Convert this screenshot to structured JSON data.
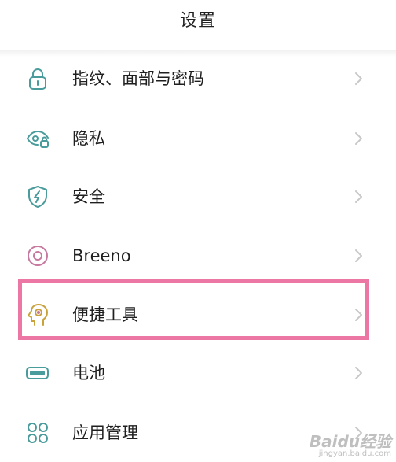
{
  "header": {
    "title": "设置"
  },
  "rows": [
    {
      "label": "指纹、面部与密码",
      "icon": "lock-icon"
    },
    {
      "label": "隐私",
      "icon": "privacy-eye-icon"
    },
    {
      "label": "安全",
      "icon": "shield-bolt-icon"
    },
    {
      "label": "Breeno",
      "icon": "breeno-icon"
    },
    {
      "label": "便捷工具",
      "icon": "head-bulb-icon",
      "highlighted": true
    },
    {
      "label": "电池",
      "icon": "battery-icon"
    },
    {
      "label": "应用管理",
      "icon": "app-grid-icon"
    }
  ],
  "colors": {
    "icon_teal": "#4a9c9c",
    "icon_pink": "#c77aa0",
    "icon_gold": "#c9a23c",
    "chevron": "#c8c8c8",
    "highlight_box": "#ec77a4"
  },
  "watermark": {
    "main": "Baidu经验",
    "sub": "jingyan.baidu.com"
  }
}
